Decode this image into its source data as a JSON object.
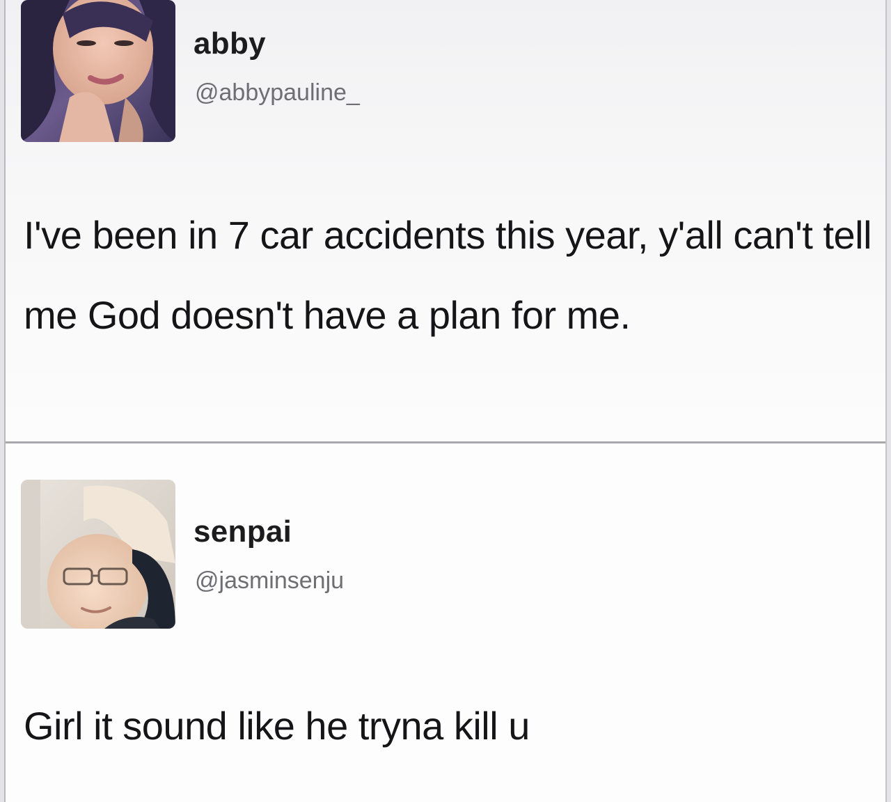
{
  "tweets": [
    {
      "display_name": "abby",
      "handle": "@abbypauline_",
      "text": "I've been in 7 car accidents this year, y'all can't tell me God doesn't have a plan for me."
    },
    {
      "display_name": "senpai",
      "handle": "@jasminsenju",
      "text": "Girl it sound like he tryna kill u"
    }
  ],
  "colors": {
    "background": "#fbfbfb",
    "divider": "#a9a9ad",
    "name_text": "#1c1c1e",
    "handle_text": "#6e6e73",
    "body_text": "#151517"
  }
}
